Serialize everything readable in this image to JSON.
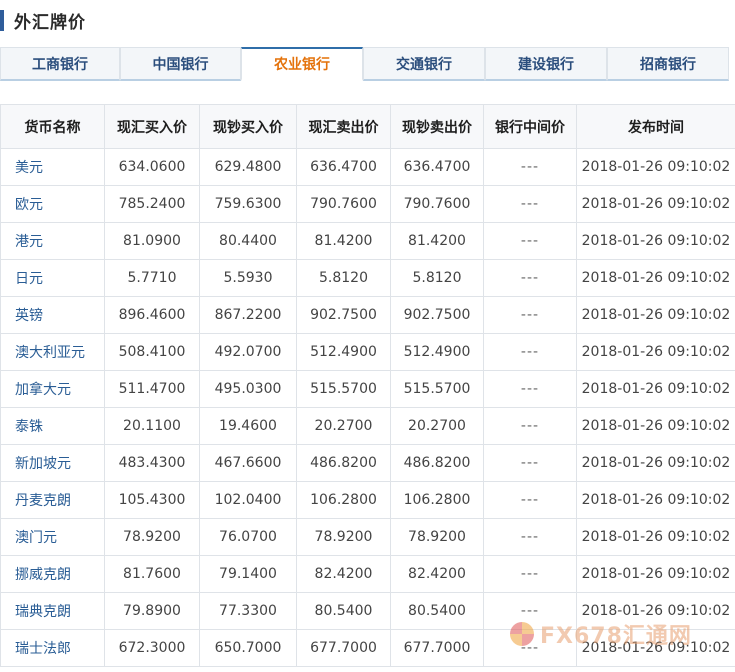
{
  "header": {
    "title": "外汇牌价"
  },
  "tabs": [
    {
      "label": "工商银行",
      "active": false
    },
    {
      "label": "中国银行",
      "active": false
    },
    {
      "label": "农业银行",
      "active": true
    },
    {
      "label": "交通银行",
      "active": false
    },
    {
      "label": "建设银行",
      "active": false
    },
    {
      "label": "招商银行",
      "active": false
    }
  ],
  "table": {
    "headers": [
      "货币名称",
      "现汇买入价",
      "现钞买入价",
      "现汇卖出价",
      "现钞卖出价",
      "银行中间价",
      "发布时间"
    ],
    "rows": [
      [
        "美元",
        "634.0600",
        "629.4800",
        "636.4700",
        "636.4700",
        "---",
        "2018-01-26 09:10:02"
      ],
      [
        "欧元",
        "785.2400",
        "759.6300",
        "790.7600",
        "790.7600",
        "---",
        "2018-01-26 09:10:02"
      ],
      [
        "港元",
        "81.0900",
        "80.4400",
        "81.4200",
        "81.4200",
        "---",
        "2018-01-26 09:10:02"
      ],
      [
        "日元",
        "5.7710",
        "5.5930",
        "5.8120",
        "5.8120",
        "---",
        "2018-01-26 09:10:02"
      ],
      [
        "英镑",
        "896.4600",
        "867.2200",
        "902.7500",
        "902.7500",
        "---",
        "2018-01-26 09:10:02"
      ],
      [
        "澳大利亚元",
        "508.4100",
        "492.0700",
        "512.4900",
        "512.4900",
        "---",
        "2018-01-26 09:10:02"
      ],
      [
        "加拿大元",
        "511.4700",
        "495.0300",
        "515.5700",
        "515.5700",
        "---",
        "2018-01-26 09:10:02"
      ],
      [
        "泰铢",
        "20.1100",
        "19.4600",
        "20.2700",
        "20.2700",
        "---",
        "2018-01-26 09:10:02"
      ],
      [
        "新加坡元",
        "483.4300",
        "467.6600",
        "486.8200",
        "486.8200",
        "---",
        "2018-01-26 09:10:02"
      ],
      [
        "丹麦克朗",
        "105.4300",
        "102.0400",
        "106.2800",
        "106.2800",
        "---",
        "2018-01-26 09:10:02"
      ],
      [
        "澳门元",
        "78.9200",
        "76.0700",
        "78.9200",
        "78.9200",
        "---",
        "2018-01-26 09:10:02"
      ],
      [
        "挪威克朗",
        "81.7600",
        "79.1400",
        "82.4200",
        "82.4200",
        "---",
        "2018-01-26 09:10:02"
      ],
      [
        "瑞典克朗",
        "79.8900",
        "77.3300",
        "80.5400",
        "80.5400",
        "---",
        "2018-01-26 09:10:02"
      ],
      [
        "瑞士法郎",
        "672.3000",
        "650.7000",
        "677.7000",
        "677.7000",
        "---",
        "2018-01-26 09:10:02"
      ]
    ]
  },
  "watermark": {
    "text": "FX678汇通网"
  }
}
